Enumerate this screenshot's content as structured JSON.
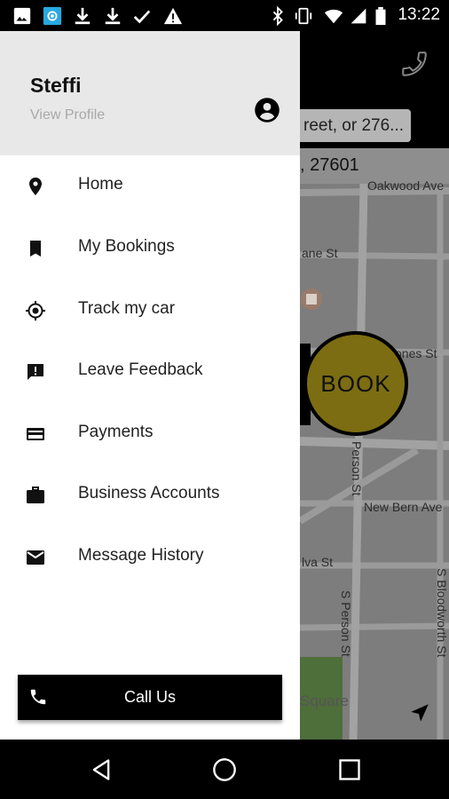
{
  "status_bar": {
    "time": "13:22",
    "left_icons": [
      "image-icon",
      "app-notification-icon",
      "download-icon",
      "download-icon",
      "check-icon",
      "warning-icon"
    ],
    "right_icons": [
      "bluetooth-icon",
      "vibrate-icon",
      "wifi-icon",
      "signal-icon",
      "battery-icon"
    ]
  },
  "map": {
    "search_text": "reet, or 276...",
    "address_text": ", 27601",
    "book_label": "BOOK",
    "street_labels": {
      "oakwood": "Oakwood Ave",
      "lane": "ane St",
      "jones": "Jones St",
      "person_top": "Person St",
      "new_bern": "New Bern Ave",
      "elva": "lva St",
      "s_person": "S Person St",
      "s_bloodworth": "S Bloodworth St",
      "square": "Square"
    }
  },
  "drawer": {
    "user_name": "Steffi",
    "view_profile": "View Profile",
    "menu_items": [
      {
        "label": "Home",
        "icon": "location-pin-icon"
      },
      {
        "label": "My Bookings",
        "icon": "bookmark-icon"
      },
      {
        "label": "Track my car",
        "icon": "gps-target-icon"
      },
      {
        "label": "Leave Feedback",
        "icon": "feedback-icon"
      },
      {
        "label": "Payments",
        "icon": "credit-card-icon"
      },
      {
        "label": "Business Accounts",
        "icon": "briefcase-icon"
      },
      {
        "label": "Message History",
        "icon": "mail-icon"
      }
    ],
    "call_label": "Call Us"
  },
  "colors": {
    "accent": "#7c6d12",
    "drawer_header_bg": "#e8e8e8",
    "map_bg": "#7c7c7c"
  }
}
